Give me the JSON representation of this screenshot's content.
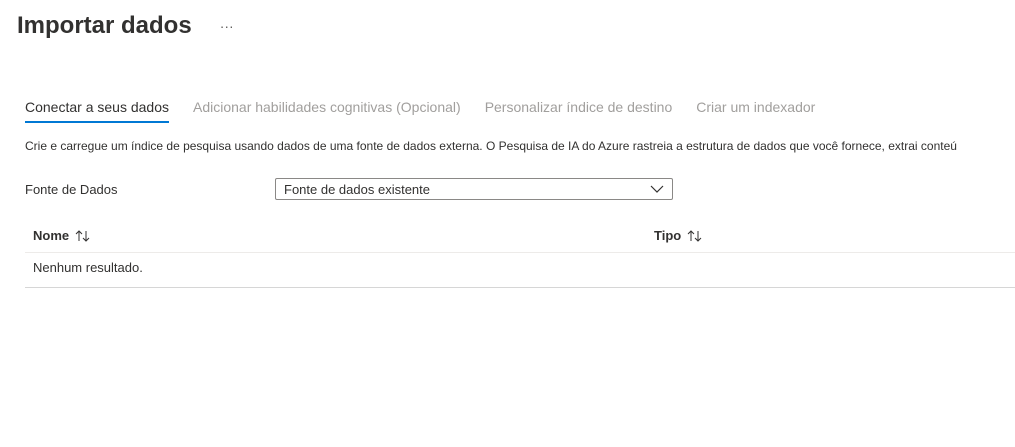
{
  "page": {
    "title": "Importar dados",
    "more_label": "···"
  },
  "tabs": [
    {
      "label": "Conectar a seus dados",
      "active": true
    },
    {
      "label": "Adicionar habilidades cognitivas (Opcional)",
      "active": false
    },
    {
      "label": "Personalizar índice de destino",
      "active": false
    },
    {
      "label": "Criar um indexador",
      "active": false
    }
  ],
  "description": "Crie e carregue um índice de pesquisa usando dados de uma fonte de dados externa. O Pesquisa de IA do Azure rastreia a estrutura de dados que você fornece, extrai conteú",
  "data_source": {
    "label": "Fonte de Dados",
    "selected": "Fonte de dados existente",
    "icon": "chevron-down-icon"
  },
  "table": {
    "columns": [
      {
        "label": "Nome",
        "icon": "sort-icon"
      },
      {
        "label": "Tipo",
        "icon": "sort-icon"
      }
    ],
    "empty_message": "Nenhum resultado."
  },
  "colors": {
    "accent": "#0078d4",
    "text": "#323130",
    "disabled_tab": "#a19f9d",
    "border": "#8a8886"
  }
}
